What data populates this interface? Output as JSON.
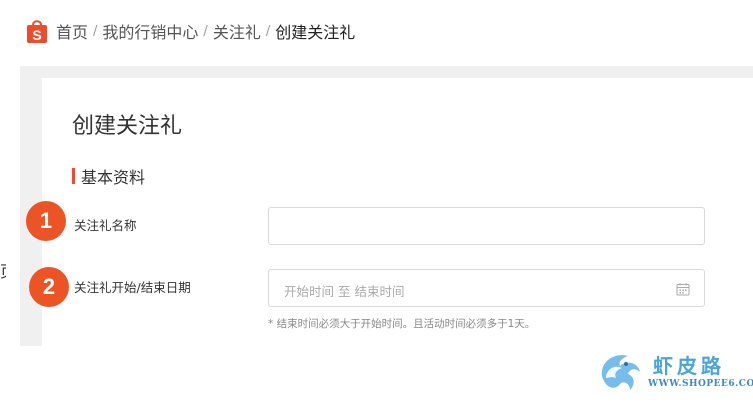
{
  "breadcrumb": {
    "home": "首页",
    "marketing": "我的行销中心",
    "follow_prize": "关注礼",
    "current": "创建关注礼",
    "separator": "/"
  },
  "page": {
    "title": "创建关注礼",
    "section_title": "基本资料"
  },
  "form": {
    "name_label": "关注礼名称",
    "name_value": "",
    "date_label": "关注礼开始/结束日期",
    "date_placeholder": "开始时间 至 结束时间",
    "date_hint": "* 结束时间必须大于开始时间。且活动时间必须多于1天。"
  },
  "badges": [
    "1",
    "2"
  ],
  "stray_text": "页",
  "watermark": {
    "cn": "虾皮路",
    "en": "WWW.SHOPEE6.COM"
  },
  "colors": {
    "accent": "#ee4d2d",
    "badge": "#ec5425",
    "watermark": "#4aa3df"
  },
  "icons": {
    "logo": "shopee-bag-logo",
    "date": "calendar-icon"
  }
}
